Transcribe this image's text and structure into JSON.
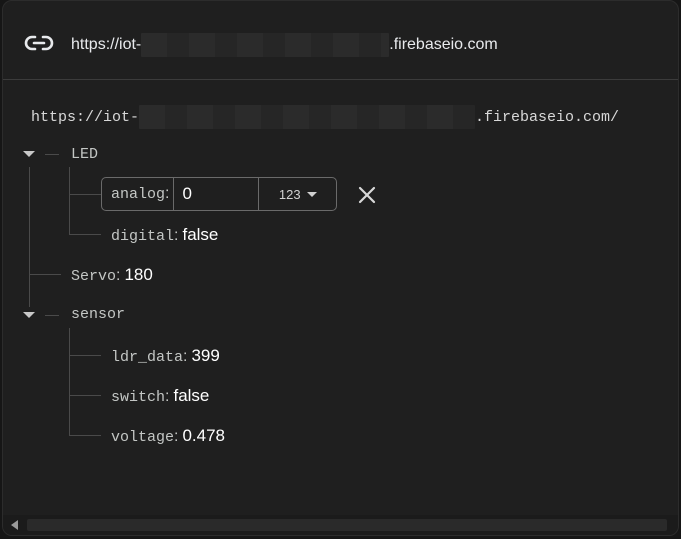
{
  "header": {
    "url_prefix": "https://iot-",
    "url_suffix": ".firebaseio.com"
  },
  "root": {
    "url_prefix": "https://iot-",
    "url_suffix": ".firebaseio.com/"
  },
  "tree": {
    "led": {
      "key": "LED",
      "analog": {
        "key": "analog",
        "colon": ":",
        "value": "0",
        "type_label": "123"
      },
      "digital": {
        "key": "digital",
        "colon": ":",
        "value": "false"
      }
    },
    "servo": {
      "key": "Servo",
      "colon": ":",
      "value": "180"
    },
    "sensor": {
      "key": "sensor",
      "ldr_data": {
        "key": "ldr_data",
        "colon": ":",
        "value": "399"
      },
      "switch": {
        "key": "switch",
        "colon": ":",
        "value": "false"
      },
      "voltage": {
        "key": "voltage",
        "colon": ":",
        "value": "0.478"
      }
    }
  },
  "icons": {
    "link": "link-icon",
    "close": "close-icon",
    "expand": "caret-down-icon",
    "scroll_left": "scroll-left-icon"
  },
  "colors": {
    "background": "#1f1f1f",
    "text_value": "#ffffff",
    "text_key": "#c4c7c5",
    "tree_line": "#4a4a4a"
  }
}
